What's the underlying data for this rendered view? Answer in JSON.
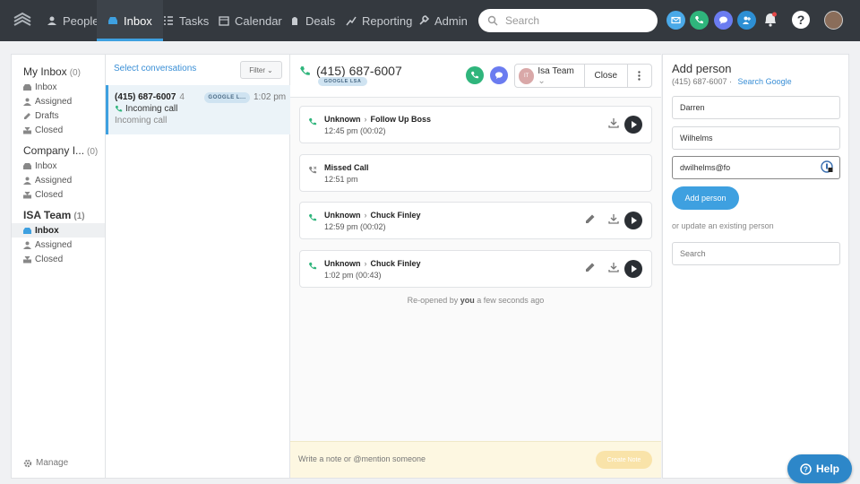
{
  "nav": {
    "items": [
      {
        "label": "People",
        "icon": "people-icon"
      },
      {
        "label": "Inbox",
        "icon": "inbox-icon",
        "active": true
      },
      {
        "label": "Tasks",
        "icon": "tasks-icon"
      },
      {
        "label": "Calendar",
        "icon": "calendar-icon"
      },
      {
        "label": "Deals",
        "icon": "deals-icon"
      },
      {
        "label": "Reporting",
        "icon": "reporting-icon"
      },
      {
        "label": "Admin",
        "icon": "admin-icon"
      }
    ],
    "search_placeholder": "Search",
    "colors": {
      "bar": "#34393f",
      "accent": "#3ea0e0",
      "email": "#4aa9e8",
      "phone": "#2fb57c",
      "chat": "#6b7cf0",
      "user": "#2d8fd4"
    }
  },
  "sidebar": {
    "sections": [
      {
        "title": "My Inbox",
        "count": "(0)",
        "items": [
          "Inbox",
          "Assigned",
          "Drafts",
          "Closed"
        ]
      },
      {
        "title": "Company I...",
        "count": "(0)",
        "items": [
          "Inbox",
          "Assigned",
          "Closed"
        ]
      },
      {
        "title": "ISA Team",
        "count": "(1)",
        "items": [
          "Inbox",
          "Assigned",
          "Closed"
        ]
      }
    ],
    "manage": "Manage"
  },
  "convlist": {
    "select_label": "Select conversations",
    "filter_label": "Filter",
    "row": {
      "phone": "(415) 687-6007",
      "count": "4",
      "badge": "GOOGLE L...",
      "time": "1:02 pm",
      "line2": "Incoming call",
      "line3": "Incoming call"
    }
  },
  "conversation": {
    "phone": "(415) 687-6007",
    "badge": "GOOGLE LSA",
    "team_initials": "IT",
    "team_name": "Isa Team",
    "close_label": "Close",
    "cards": [
      {
        "from": "Unknown",
        "to": "Follow Up Boss",
        "time": "12:45 pm (00:02)"
      },
      {
        "from": "Missed Call",
        "to": "",
        "time": "12:51 pm"
      },
      {
        "from": "Unknown",
        "to": "Chuck Finley",
        "time": "12:59 pm (00:02)"
      },
      {
        "from": "Unknown",
        "to": "Chuck Finley",
        "time": "1:02 pm (00:43)"
      }
    ],
    "reopened_prefix": "Re-opened by",
    "reopened_by": "you",
    "reopened_suffix": "a few seconds ago",
    "note_placeholder": "Write a note or @mention someone",
    "create_note": "Create Note"
  },
  "add_person": {
    "title": "Add person",
    "phone": "(415) 687-6007",
    "search_google": "Search Google",
    "first_name": "Darren",
    "last_name": "Wilhelms",
    "email": "dwilhelms@fo",
    "add_label": "Add person",
    "or_update": "or update an existing person",
    "search_placeholder": "Search"
  },
  "help_label": "Help"
}
